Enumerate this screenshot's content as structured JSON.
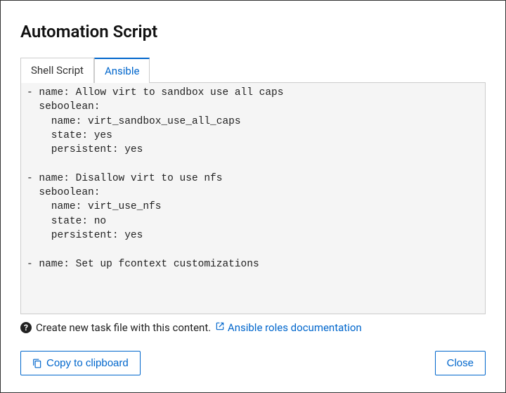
{
  "modal": {
    "title": "Automation Script",
    "helper_text": "Create new task file with this content.",
    "link_text": "Ansible roles documentation"
  },
  "tabs": {
    "shell": "Shell Script",
    "ansible": "Ansible"
  },
  "code": "- name: Allow virt to sandbox use all caps\n  seboolean:\n    name: virt_sandbox_use_all_caps\n    state: yes\n    persistent: yes\n\n- name: Disallow virt to use nfs\n  seboolean:\n    name: virt_use_nfs\n    state: no\n    persistent: yes\n\n- name: Set up fcontext customizations\n                                                                                          ",
  "buttons": {
    "copy": "Copy to clipboard",
    "close": "Close"
  }
}
